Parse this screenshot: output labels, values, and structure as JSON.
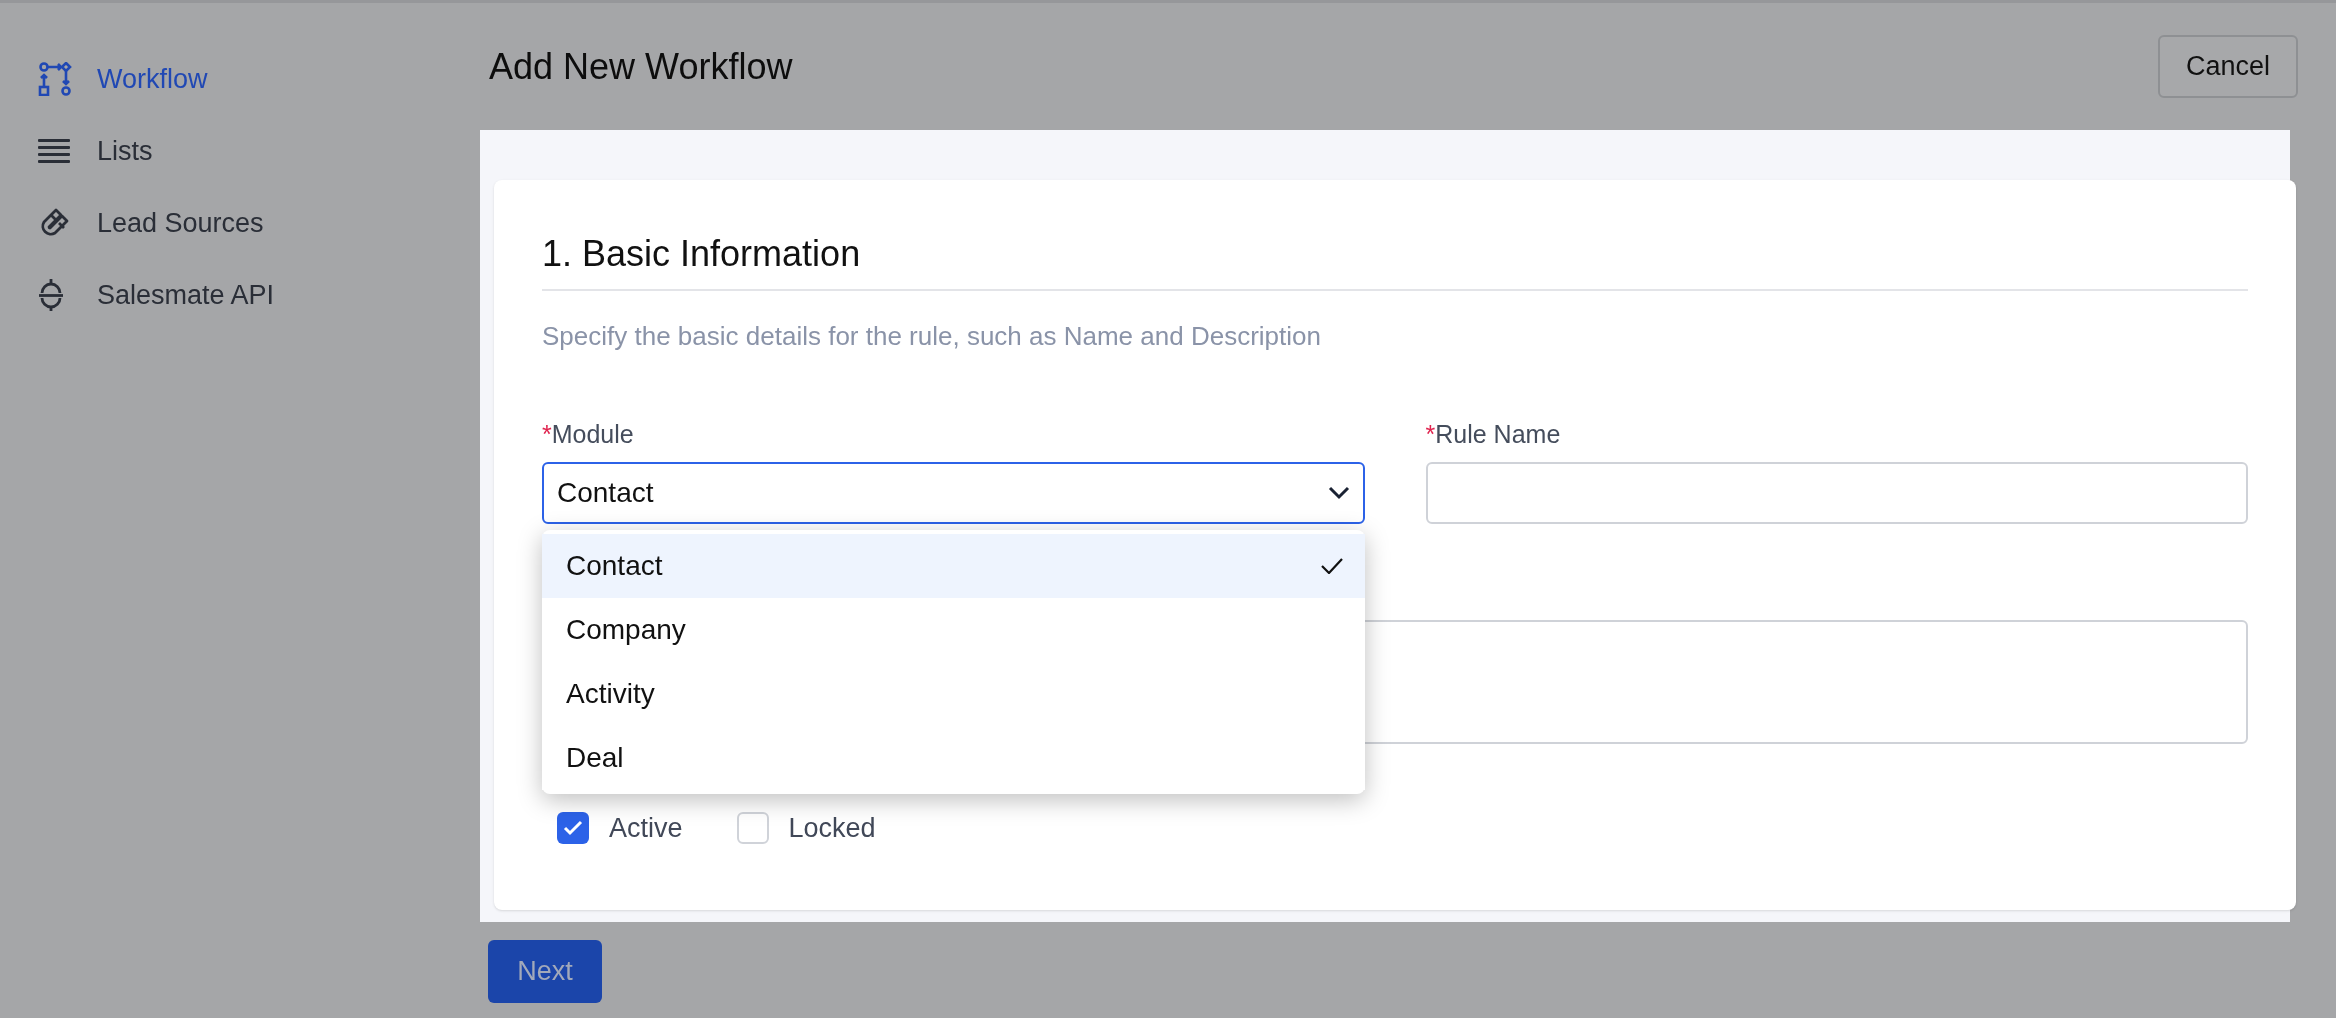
{
  "sidebar": {
    "items": [
      {
        "kind": "workflow",
        "label": "Workflow",
        "selected": true
      },
      {
        "kind": "lists",
        "label": "Lists",
        "selected": false
      },
      {
        "kind": "magnet",
        "label": "Lead Sources",
        "selected": false
      },
      {
        "kind": "api",
        "label": "Salesmate API",
        "selected": false
      }
    ]
  },
  "header": {
    "title": "Add New Workflow",
    "cancel_button": "Cancel"
  },
  "section": {
    "title": "1. Basic Information",
    "description": "Specify the basic details for the rule, such as Name and Description",
    "fields": [
      {
        "kind": "select",
        "label": "Module",
        "required_mark": "*",
        "value": "Contact",
        "open": true,
        "options": [
          {
            "label": "Contact",
            "selected": true
          },
          {
            "label": "Company",
            "selected": false
          },
          {
            "label": "Activity",
            "selected": false
          },
          {
            "label": "Deal",
            "selected": false
          }
        ]
      },
      {
        "kind": "text",
        "label": "Rule Name",
        "required_mark": "*"
      }
    ],
    "textarea": {
      "kind": "textarea"
    },
    "checkboxes": [
      {
        "label": "Active",
        "checked": true
      },
      {
        "label": "Locked",
        "checked": false
      }
    ]
  },
  "next_button": "Next"
}
